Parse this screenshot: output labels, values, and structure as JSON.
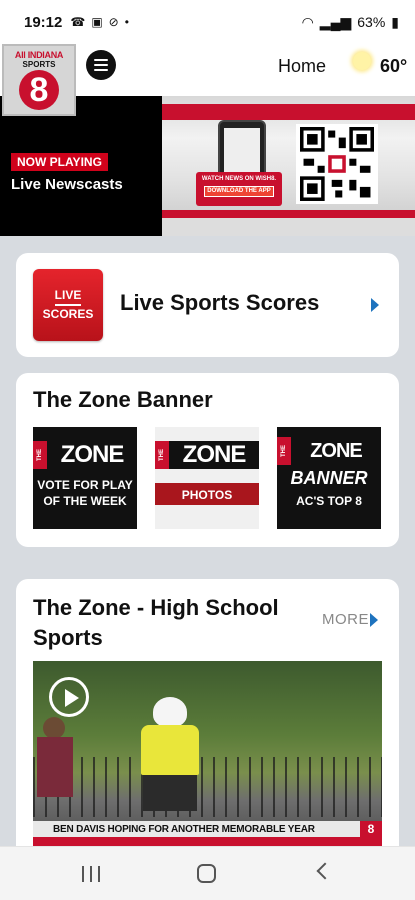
{
  "status_bar": {
    "time": "19:12",
    "battery": "63%"
  },
  "header": {
    "logo_line1": "All INDIANA",
    "logo_line2": "SPORTS",
    "logo_number": "8",
    "home_label": "Home",
    "temperature": "60°",
    "weather_icon": "sun-icon"
  },
  "hero": {
    "badge": "NOW PLAYING",
    "title": "Live Newscasts",
    "promo_line": "WATCH NEWS ON WISH8.",
    "promo_button": "DOWNLOAD THE APP"
  },
  "scores_card": {
    "tile_line1": "LIVE",
    "tile_line2": "SCORES",
    "title": "Live Sports Scores"
  },
  "zone_banner": {
    "title": "The Zone Banner",
    "tiles": [
      {
        "the": "THE",
        "word": "ZONE",
        "sub": "VOTE FOR PLAY OF THE WEEK"
      },
      {
        "the": "THE",
        "word": "ZONE",
        "sub": "PHOTOS"
      },
      {
        "the": "THE",
        "word": "ZONE",
        "word2": "BANNER",
        "sub": "AC'S TOP 8"
      }
    ]
  },
  "high_school": {
    "title": "The Zone - High School Sports",
    "more": "MORE",
    "video_caption": "BEN DAVIS HOPING FOR ANOTHER MEMORABLE YEAR",
    "video_logo": "8"
  },
  "colors": {
    "brand_red": "#c8102e",
    "link_blue": "#1e73be",
    "content_bg": "#d7dbe0"
  }
}
